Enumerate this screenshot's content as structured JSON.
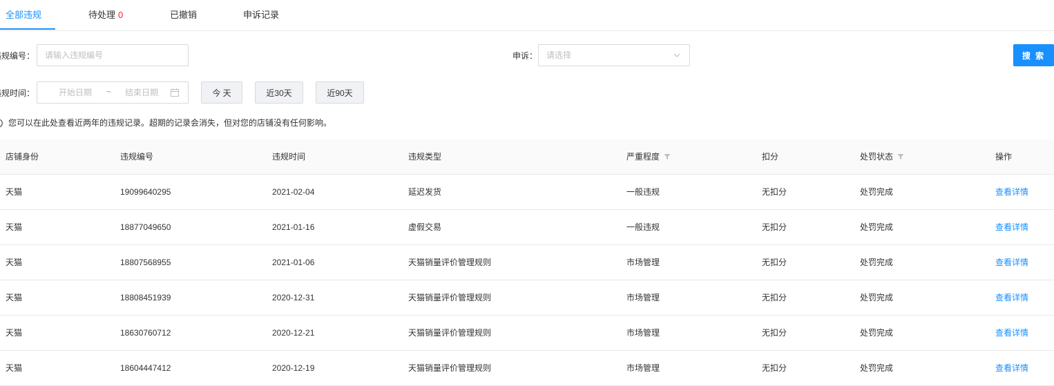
{
  "tabs": [
    {
      "label": "全部违规",
      "active": true
    },
    {
      "label": "待处理",
      "count": "0"
    },
    {
      "label": "已撤销"
    },
    {
      "label": "申诉记录"
    }
  ],
  "form": {
    "violation_id_label": "违规编号：",
    "violation_id_placeholder": "请输入违规编号",
    "appeal_label": "申诉：",
    "appeal_placeholder": "请选择",
    "search_button": "搜 索",
    "time_label": "违规时间：",
    "start_placeholder": "开始日期",
    "range_separator": "~",
    "end_placeholder": "结束日期",
    "quick_today": "今 天",
    "quick_30": "近30天",
    "quick_90": "近90天"
  },
  "notice": "您可以在此处查看近两年的违规记录。超期的记录会消失，但对您的店铺没有任何影响。",
  "table": {
    "columns": [
      "店铺身份",
      "违规编号",
      "违规时间",
      "违规类型",
      "严重程度",
      "扣分",
      "处罚状态",
      "操作"
    ],
    "rows": [
      {
        "shop": "天猫",
        "id": "19099640295",
        "time": "2021-02-04",
        "type": "延迟发货",
        "severity": "一般违规",
        "points": "无扣分",
        "status": "处罚完成",
        "action": "查看详情"
      },
      {
        "shop": "天猫",
        "id": "18877049650",
        "time": "2021-01-16",
        "type": "虚假交易",
        "severity": "一般违规",
        "points": "无扣分",
        "status": "处罚完成",
        "action": "查看详情"
      },
      {
        "shop": "天猫",
        "id": "18807568955",
        "time": "2021-01-06",
        "type": "天猫销量评价管理规则",
        "severity": "市场管理",
        "points": "无扣分",
        "status": "处罚完成",
        "action": "查看详情"
      },
      {
        "shop": "天猫",
        "id": "18808451939",
        "time": "2020-12-31",
        "type": "天猫销量评价管理规则",
        "severity": "市场管理",
        "points": "无扣分",
        "status": "处罚完成",
        "action": "查看详情"
      },
      {
        "shop": "天猫",
        "id": "18630760712",
        "time": "2020-12-21",
        "type": "天猫销量评价管理规则",
        "severity": "市场管理",
        "points": "无扣分",
        "status": "处罚完成",
        "action": "查看详情"
      },
      {
        "shop": "天猫",
        "id": "18604447412",
        "time": "2020-12-19",
        "type": "天猫销量评价管理规则",
        "severity": "市场管理",
        "points": "无扣分",
        "status": "处罚完成",
        "action": "查看详情"
      }
    ]
  },
  "icons": {
    "chevron": "chevron-down-icon",
    "calendar": "calendar-icon",
    "info": "info-circle-icon",
    "filter": "filter-icon"
  },
  "colors": {
    "accent": "#1890ff",
    "badge": "#f5222d",
    "header_bg": "#fafafa",
    "border": "#e8e8e8"
  }
}
